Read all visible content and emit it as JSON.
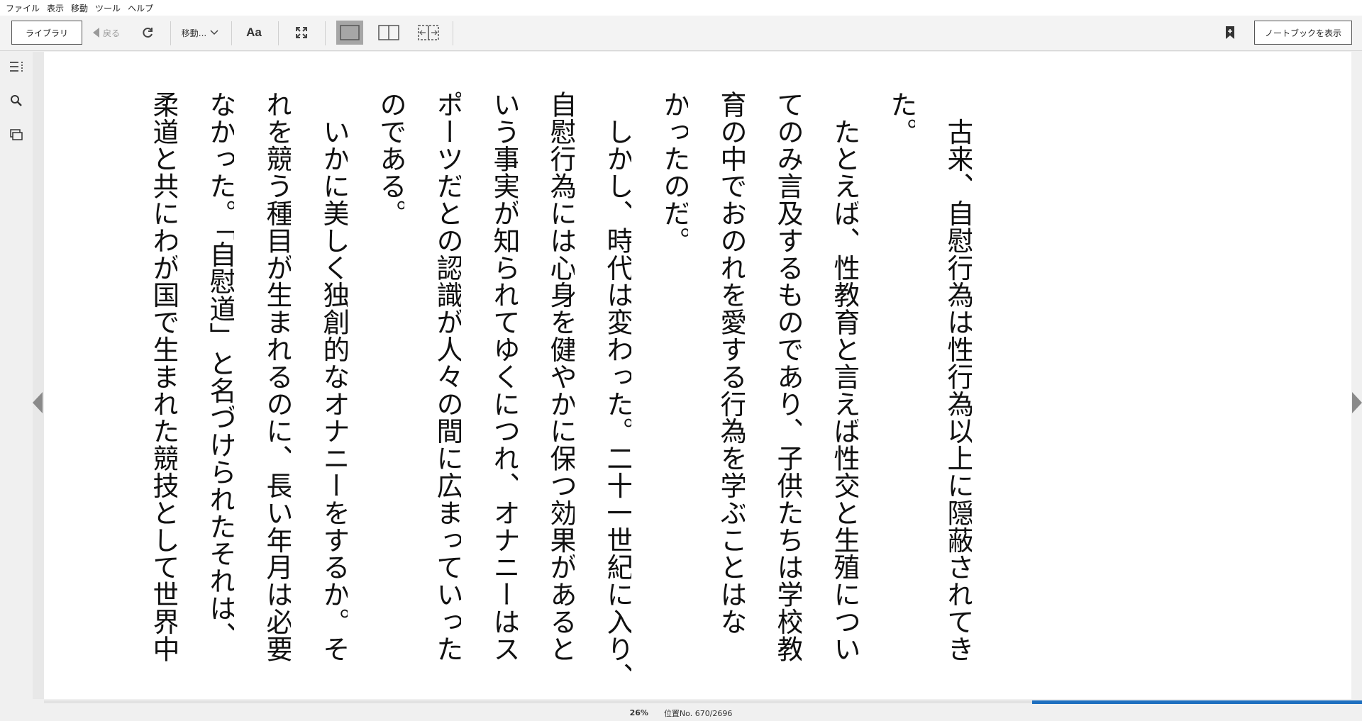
{
  "menubar": {
    "items": [
      "ファイル",
      "表示",
      "移動",
      "ツール",
      "ヘルプ"
    ]
  },
  "toolbar": {
    "library_label": "ライブラリ",
    "back_label": "戻る",
    "goto_label": "移動...",
    "font_label": "Aa",
    "notebook_label": "ノートブックを表示"
  },
  "page": {
    "columns": [
      "　古来、自慰行為は性行為以上に隠蔽されてき",
      "た。",
      "　たとえば、性教育と言えば性交と生殖につい",
      "てのみ言及するものであり、子供たちは学校教",
      "育の中でおのれを愛する行為を学ぶことはな",
      "かったのだ。",
      "　しかし、時代は変わった。二十一世紀に入り、",
      "自慰行為には心身を健やかに保つ効果があると",
      "いう事実が知られてゆくにつれ、オナニーはス",
      "ポーツだとの認識が人々の間に広まっていった",
      "のである。",
      "　いかに美しく独創的なオナニーをするか。そ",
      "れを競う種目が生まれるのに、長い年月は必要",
      "なかった。「自慰道」と名づけられたそれは、",
      "柔道と共にわが国で生まれた競技として世界中"
    ]
  },
  "status": {
    "percent": "26%",
    "location": "位置No. 670/2696",
    "progress_fraction": 0.26
  },
  "colors": {
    "progress": "#1e6fbf",
    "selected_layout": "#a6a6a6"
  }
}
